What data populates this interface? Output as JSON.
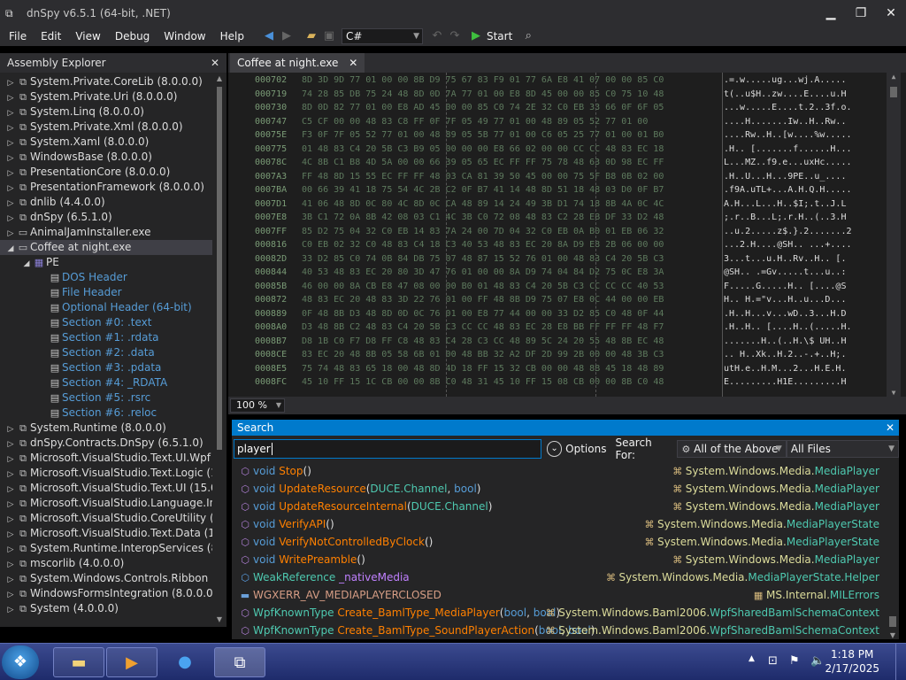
{
  "window": {
    "title": "dnSpy v6.5.1 (64-bit, .NET)"
  },
  "menu": [
    "File",
    "Edit",
    "View",
    "Debug",
    "Window",
    "Help"
  ],
  "toolbar": {
    "language": "C#",
    "start_label": "Start"
  },
  "assembly_explorer": {
    "title": "Assembly Explorer",
    "items": [
      {
        "label": "System.Private.CoreLib (8.0.0.0)",
        "level": 0,
        "type": "assembly"
      },
      {
        "label": "System.Private.Uri (8.0.0.0)",
        "level": 0,
        "type": "assembly"
      },
      {
        "label": "System.Linq (8.0.0.0)",
        "level": 0,
        "type": "assembly"
      },
      {
        "label": "System.Private.Xml (8.0.0.0)",
        "level": 0,
        "type": "assembly"
      },
      {
        "label": "System.Xaml (8.0.0.0)",
        "level": 0,
        "type": "assembly"
      },
      {
        "label": "WindowsBase (8.0.0.0)",
        "level": 0,
        "type": "assembly"
      },
      {
        "label": "PresentationCore (8.0.0.0)",
        "level": 0,
        "type": "assembly"
      },
      {
        "label": "PresentationFramework (8.0.0.0)",
        "level": 0,
        "type": "assembly"
      },
      {
        "label": "dnlib (4.4.0.0)",
        "level": 0,
        "type": "assembly"
      },
      {
        "label": "dnSpy (6.5.1.0)",
        "level": 0,
        "type": "assembly"
      },
      {
        "label": "AnimalJamInstaller.exe",
        "level": 0,
        "type": "file"
      },
      {
        "label": "Coffee at night.exe",
        "level": 0,
        "type": "file",
        "selected": true
      },
      {
        "label": "PE",
        "level": 1,
        "type": "pe"
      },
      {
        "label": "DOS Header",
        "level": 2,
        "type": "link"
      },
      {
        "label": "File Header",
        "level": 2,
        "type": "link"
      },
      {
        "label": "Optional Header (64-bit)",
        "level": 2,
        "type": "link"
      },
      {
        "label": "Section #0: .text",
        "level": 2,
        "type": "link"
      },
      {
        "label": "Section #1: .rdata",
        "level": 2,
        "type": "link"
      },
      {
        "label": "Section #2: .data",
        "level": 2,
        "type": "link"
      },
      {
        "label": "Section #3: .pdata",
        "level": 2,
        "type": "link"
      },
      {
        "label": "Section #4: _RDATA",
        "level": 2,
        "type": "link"
      },
      {
        "label": "Section #5: .rsrc",
        "level": 2,
        "type": "link"
      },
      {
        "label": "Section #6: .reloc",
        "level": 2,
        "type": "link"
      },
      {
        "label": "System.Runtime (8.0.0.0)",
        "level": 0,
        "type": "assembly"
      },
      {
        "label": "dnSpy.Contracts.DnSpy (6.5.1.0)",
        "level": 0,
        "type": "assembly"
      },
      {
        "label": "Microsoft.VisualStudio.Text.UI.Wpf (1",
        "level": 0,
        "type": "assembly"
      },
      {
        "label": "Microsoft.VisualStudio.Text.Logic (15",
        "level": 0,
        "type": "assembly"
      },
      {
        "label": "Microsoft.VisualStudio.Text.UI (15.0.0",
        "level": 0,
        "type": "assembly"
      },
      {
        "label": "Microsoft.VisualStudio.Language.Int",
        "level": 0,
        "type": "assembly"
      },
      {
        "label": "Microsoft.VisualStudio.CoreUtility (1",
        "level": 0,
        "type": "assembly"
      },
      {
        "label": "Microsoft.VisualStudio.Text.Data (15.",
        "level": 0,
        "type": "assembly"
      },
      {
        "label": "System.Runtime.InteropServices (8.0",
        "level": 0,
        "type": "assembly"
      },
      {
        "label": "mscorlib (4.0.0.0)",
        "level": 0,
        "type": "assembly"
      },
      {
        "label": "System.Windows.Controls.Ribbon (8",
        "level": 0,
        "type": "assembly"
      },
      {
        "label": "WindowsFormsIntegration (8.0.0.0)",
        "level": 0,
        "type": "assembly"
      },
      {
        "label": "System (4.0.0.0)",
        "level": 0,
        "type": "assembly"
      }
    ]
  },
  "document": {
    "tab": "Coffee at night.exe",
    "zoom": "100 %",
    "hex_rows": [
      {
        "addr": "000702",
        "bytes": "8D 3D 9D 77 01 00 00 8B D9 75 67 83 F9 01 77 6A E8 41 07 00 00 85 C0",
        "ascii": ".=.w.....ug...wj.A....."
      },
      {
        "addr": "000719",
        "bytes": "74 28 85 DB 75 24 48 8D 0D 7A 77 01 00 E8 8D 45 00 00 85 C0 75 10 48",
        "ascii": "t(..u$H..zw....E....u.H"
      },
      {
        "addr": "000730",
        "bytes": "8D 0D 82 77 01 00 E8 AD 45 00 00 85 C0 74 2E 32 C0 EB 33 66 0F 6F 05",
        "ascii": "...w.....E....t.2..3f.o."
      },
      {
        "addr": "000747",
        "bytes": "C5 CF 00 00 48 83 C8 FF 0F 7F 05 49 77 01 00 48 89 05 52 77 01 00",
        "ascii": "....H.......Iw..H..Rw.."
      },
      {
        "addr": "00075E",
        "bytes": "F3 0F 7F 05 52 77 01 00 48 89 05 5B 77 01 00 C6 05 25 77 01 00 01 B0",
        "ascii": "....Rw..H..[w....%w....."
      },
      {
        "addr": "000775",
        "bytes": "01 48 83 C4 20 5B C3 B9 05 00 00 00 E8 66 02 00 00 CC CC 48 83 EC 18",
        "ascii": ".H.. [.......f......H..."
      },
      {
        "addr": "00078C",
        "bytes": "4C 8B C1 B8 4D 5A 00 00 66 39 05 65 EC FF FF 75 78 48 63 0D 98 EC FF",
        "ascii": "L...MZ..f9.e...uxHc....."
      },
      {
        "addr": "0007A3",
        "bytes": "FF 48 8D 15 55 EC FF FF 48 03 CA 81 39 50 45 00 00 75 5F B8 0B 02 00",
        "ascii": ".H..U...H...9PE..u_...."
      },
      {
        "addr": "0007BA",
        "bytes": "00 66 39 41 18 75 54 4C 2B C2 0F B7 41 14 48 8D 51 18 48 03 D0 0F B7",
        "ascii": ".f9A.uTL+...A.H.Q.H....."
      },
      {
        "addr": "0007D1",
        "bytes": "41 06 48 8D 0C 80 4C 8D 0C CA 48 89 14 24 49 3B D1 74 18 8B 4A 0C 4C",
        "ascii": "A.H...L...H..$I;.t..J.L"
      },
      {
        "addr": "0007E8",
        "bytes": "3B C1 72 0A 8B 42 08 03 C1 4C 3B C0 72 08 48 83 C2 28 EB DF 33 D2 48",
        "ascii": ";.r..B...L;.r.H..(..3.H"
      },
      {
        "addr": "0007FF",
        "bytes": "85 D2 75 04 32 C0 EB 14 83 7A 24 00 7D 04 32 C0 EB 0A B0 01 EB 06 32",
        "ascii": "..u.2.....z$.}.2.......2"
      },
      {
        "addr": "000816",
        "bytes": "C0 EB 02 32 C0 48 83 C4 18 C3 40 53 48 83 EC 20 8A D9 E8 2B 06 00 00",
        "ascii": "...2.H....@SH.. ...+...."
      },
      {
        "addr": "00082D",
        "bytes": "33 D2 85 C0 74 0B 84 DB 75 07 48 87 15 52 76 01 00 48 83 C4 20 5B C3",
        "ascii": "3...t...u.H..Rv..H.. [."
      },
      {
        "addr": "000844",
        "bytes": "40 53 48 83 EC 20 80 3D 47 76 01 00 00 8A D9 74 04 84 D2 75 0C E8 3A",
        "ascii": "@SH.. .=Gv.....t...u..:"
      },
      {
        "addr": "00085B",
        "bytes": "46 00 00 8A CB E8 47 08 00 00 B0 01 48 83 C4 20 5B C3 CC CC CC 40 53",
        "ascii": "F.....G.....H.. [....@S"
      },
      {
        "addr": "000872",
        "bytes": "48 83 EC 20 48 83 3D 22 76 01 00 FF 48 8B D9 75 07 E8 0C 44 00 00 EB",
        "ascii": "H.. H.=\"v...H..u...D..."
      },
      {
        "addr": "000889",
        "bytes": "0F 48 8B D3 48 8D 0D 0C 76 01 00 E8 77 44 00 00 33 D2 85 C0 48 0F 44",
        "ascii": ".H..H...v...wD..3...H.D"
      },
      {
        "addr": "0008A0",
        "bytes": "D3 48 8B C2 48 83 C4 20 5B C3 CC CC 48 83 EC 28 E8 BB FF FF FF 48 F7",
        "ascii": ".H..H.. [....H..(.....H."
      },
      {
        "addr": "0008B7",
        "bytes": "D8 1B C0 F7 D8 FF C8 48 83 C4 28 C3 CC 48 89 5C 24 20 55 48 8B EC 48",
        "ascii": ".......H..(..H.\\$ UH..H"
      },
      {
        "addr": "0008CE",
        "bytes": "83 EC 20 48 8B 05 58 6B 01 00 48 BB 32 A2 DF 2D 99 2B 00 00 48 3B C3",
        "ascii": ".. H..Xk..H.2..-.+..H;."
      },
      {
        "addr": "0008E5",
        "bytes": "75 74 48 83 65 18 00 48 8D 4D 18 FF 15 32 CB 00 00 48 8B 45 18 48 89",
        "ascii": "utH.e..H.M...2...H.E.H."
      },
      {
        "addr": "0008FC",
        "bytes": "45 10 FF 15 1C CB 00 00 8B C0 48 31 45 10 FF 15 08 CB 00 00 8B C0 48",
        "ascii": "E.........H1E.........H"
      }
    ]
  },
  "search": {
    "title": "Search",
    "query": "player",
    "options_label": "Options",
    "search_for_label": "Search For:",
    "search_for_value": "All of the Above",
    "scope_value": "All Files",
    "results": [
      {
        "icon": "method",
        "kind": "void",
        "name": "Stop",
        "args": [],
        "ns": "System.Windows.Media.",
        "type": "MediaPlayer",
        "ns_icon": "namespace"
      },
      {
        "icon": "method",
        "kind": "void",
        "name": "UpdateResource",
        "args": [
          "DUCE.Channel",
          "bool"
        ],
        "ns": "System.Windows.Media.",
        "type": "MediaPlayer",
        "ns_icon": "namespace"
      },
      {
        "icon": "method",
        "kind": "void",
        "name": "UpdateResourceInternal",
        "args": [
          "DUCE.Channel"
        ],
        "ns": "System.Windows.Media.",
        "type": "MediaPlayer",
        "ns_icon": "namespace"
      },
      {
        "icon": "method",
        "kind": "void",
        "name": "VerifyAPI",
        "args": [],
        "ns": "System.Windows.Media.",
        "type": "MediaPlayerState",
        "ns_icon": "namespace"
      },
      {
        "icon": "method",
        "kind": "void",
        "name": "VerifyNotControlledByClock",
        "args": [],
        "ns": "System.Windows.Media.",
        "type": "MediaPlayerState",
        "ns_icon": "namespace"
      },
      {
        "icon": "method",
        "kind": "void",
        "name": "WritePreamble",
        "args": [],
        "ns": "System.Windows.Media.",
        "type": "MediaPlayer",
        "ns_icon": "namespace"
      },
      {
        "icon": "field",
        "kind": "WeakReference",
        "name": "_nativeMedia",
        "args": null,
        "ns": "System.Windows.Media.",
        "type": "MediaPlayerState.Helper",
        "ns_icon": "namespace"
      },
      {
        "icon": "const",
        "kind": "",
        "name": "WGXERR_AV_MEDIAPLAYERCLOSED",
        "args": null,
        "ns": "MS.Internal.",
        "type": "MILErrors",
        "ns_icon": "class"
      },
      {
        "icon": "method",
        "kind": "WpfKnownType",
        "name": "Create_BamlType_MediaPlayer",
        "args": [
          "bool",
          "bool"
        ],
        "ns": "System.Windows.Baml2006.",
        "type": "WpfSharedBamlSchemaContext",
        "ns_icon": "namespace"
      },
      {
        "icon": "method",
        "kind": "WpfKnownType",
        "name": "Create_BamlType_SoundPlayerAction",
        "args": [
          "bool",
          "bool"
        ],
        "ns": "System.Windows.Baml2006.",
        "type": "WpfSharedBamlSchemaContext",
        "ns_icon": "namespace"
      }
    ]
  },
  "taskbar": {
    "time": "1:18 PM",
    "date": "2/17/2025"
  }
}
